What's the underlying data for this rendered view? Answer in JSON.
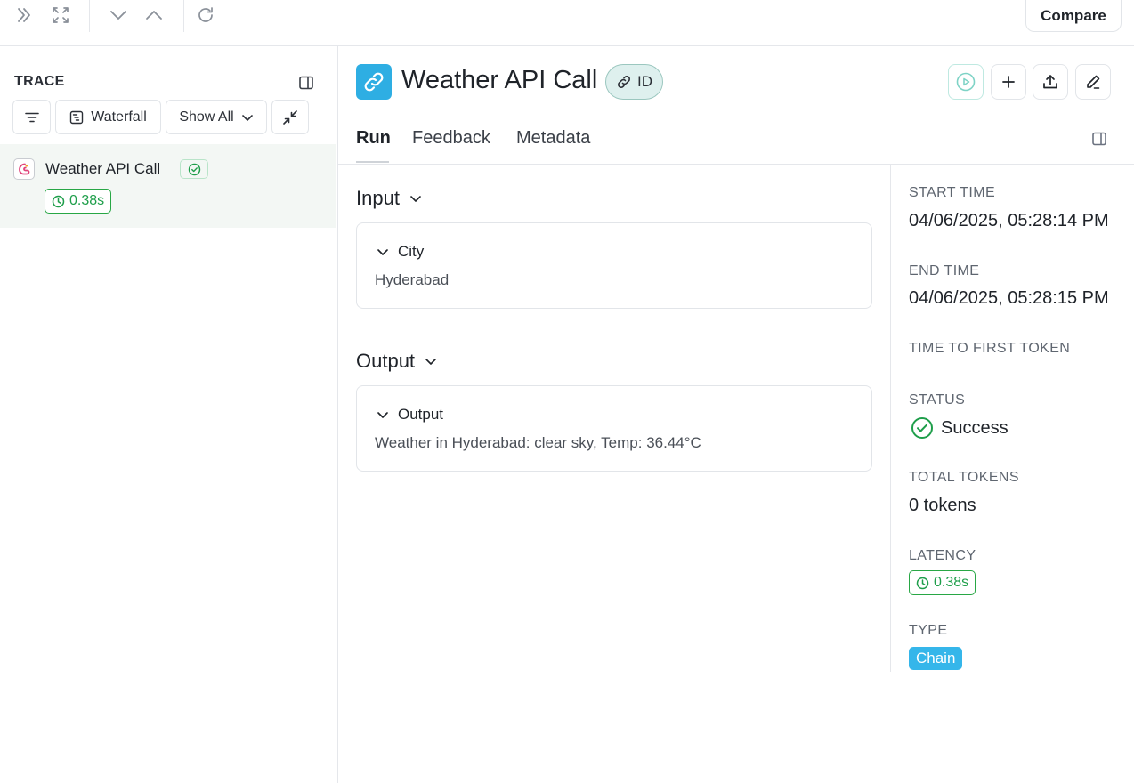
{
  "toolbar": {
    "compare_label": "Compare"
  },
  "sidebar": {
    "title": "TRACE",
    "waterfall_label": "Waterfall",
    "show_all_label": "Show All",
    "run": {
      "name": "Weather API Call",
      "latency": "0.38s"
    }
  },
  "header": {
    "title": "Weather API Call",
    "id_label": "ID"
  },
  "tabs": [
    {
      "label": "Run"
    },
    {
      "label": "Feedback"
    },
    {
      "label": "Metadata"
    }
  ],
  "input": {
    "heading": "Input",
    "key": "City",
    "value": "Hyderabad"
  },
  "output": {
    "heading": "Output",
    "key": "Output",
    "value": "Weather in Hyderabad: clear sky, Temp: 36.44°C"
  },
  "details": {
    "start_time_label": "START TIME",
    "start_time": "04/06/2025, 05:28:14 PM",
    "end_time_label": "END TIME",
    "end_time": "04/06/2025, 05:28:15 PM",
    "ttft_label": "TIME TO FIRST TOKEN",
    "status_label": "STATUS",
    "status": "Success",
    "total_tokens_label": "TOTAL TOKENS",
    "total_tokens": "0 tokens",
    "latency_label": "LATENCY",
    "latency": "0.38s",
    "type_label": "TYPE",
    "type": "Chain"
  },
  "colors": {
    "accent_blue": "#2eaee3",
    "success_green": "#28a745",
    "selected_row_bg": "#f3f7f4"
  }
}
